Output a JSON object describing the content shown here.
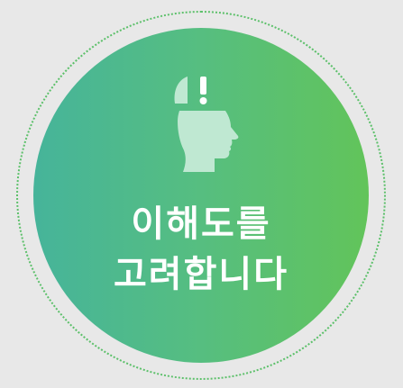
{
  "badge": {
    "line1": "이해도를",
    "line2": "고려합니다",
    "icon": "open-head-exclamation-icon",
    "colors": {
      "gradient_start": "#46b49a",
      "gradient_end": "#62c45a",
      "icon": "#bfe8d2",
      "text": "#ffffff",
      "ring": "#5cc06a",
      "background": "#e8e8e8"
    }
  }
}
